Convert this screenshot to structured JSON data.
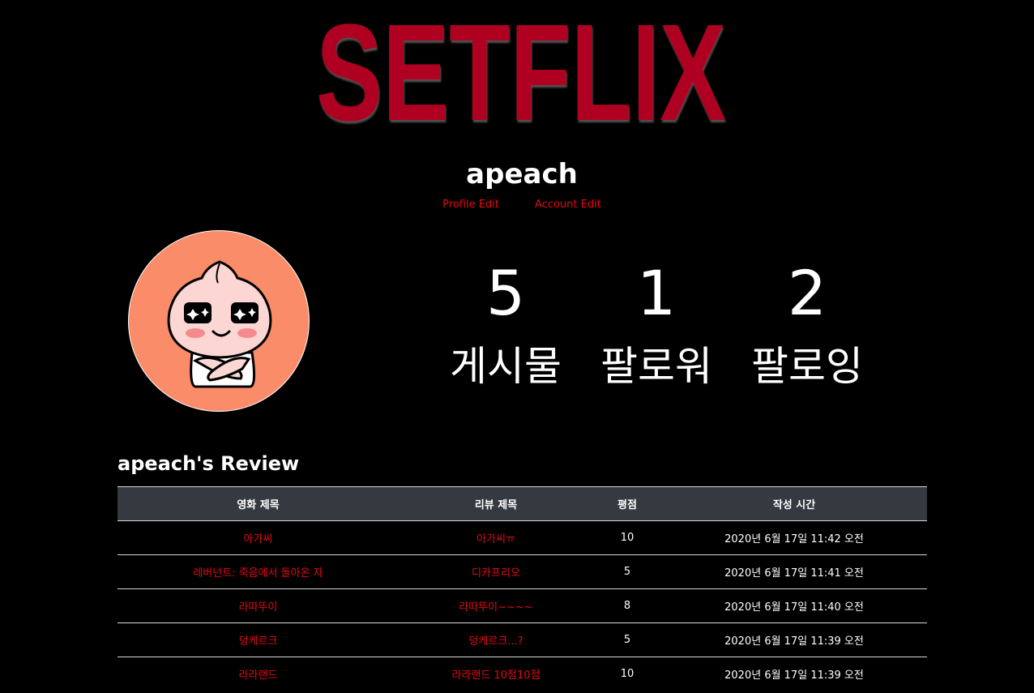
{
  "brand": {
    "logo_text": "SETFLIX",
    "color": "#b00020"
  },
  "profile": {
    "username": "apeach",
    "profile_edit_label": "Profile Edit",
    "account_edit_label": "Account Edit",
    "avatar_icon": "apeach-character-icon",
    "stats": [
      {
        "value": "5",
        "label": "게시물"
      },
      {
        "value": "1",
        "label": "팔로워"
      },
      {
        "value": "2",
        "label": "팔로잉"
      }
    ]
  },
  "reviews": {
    "title": "apeach's Review",
    "columns": [
      "영화 제목",
      "리뷰 제목",
      "평점",
      "작성 시간"
    ],
    "rows": [
      {
        "movie": "아가씨",
        "review": "아가씨ㅠ",
        "score": "10",
        "time": "2020년 6월 17일 11:42 오전"
      },
      {
        "movie": "레버넌트: 죽음에서 돌아온 자",
        "review": "디카프리오",
        "score": "5",
        "time": "2020년 6월 17일 11:41 오전"
      },
      {
        "movie": "라따뚜이",
        "review": "라따뚜이~~~~",
        "score": "8",
        "time": "2020년 6월 17일 11:40 오전"
      },
      {
        "movie": "덩케르크",
        "review": "덩케르크...?",
        "score": "5",
        "time": "2020년 6월 17일 11:39 오전"
      },
      {
        "movie": "라라랜드",
        "review": "라라랜드 10점10점",
        "score": "10",
        "time": "2020년 6월 17일 11:39 오전"
      }
    ]
  },
  "colors": {
    "background": "#000000",
    "link": "#e50914",
    "table_header": "#343a40",
    "avatar_bg": "#fb8c6a"
  }
}
